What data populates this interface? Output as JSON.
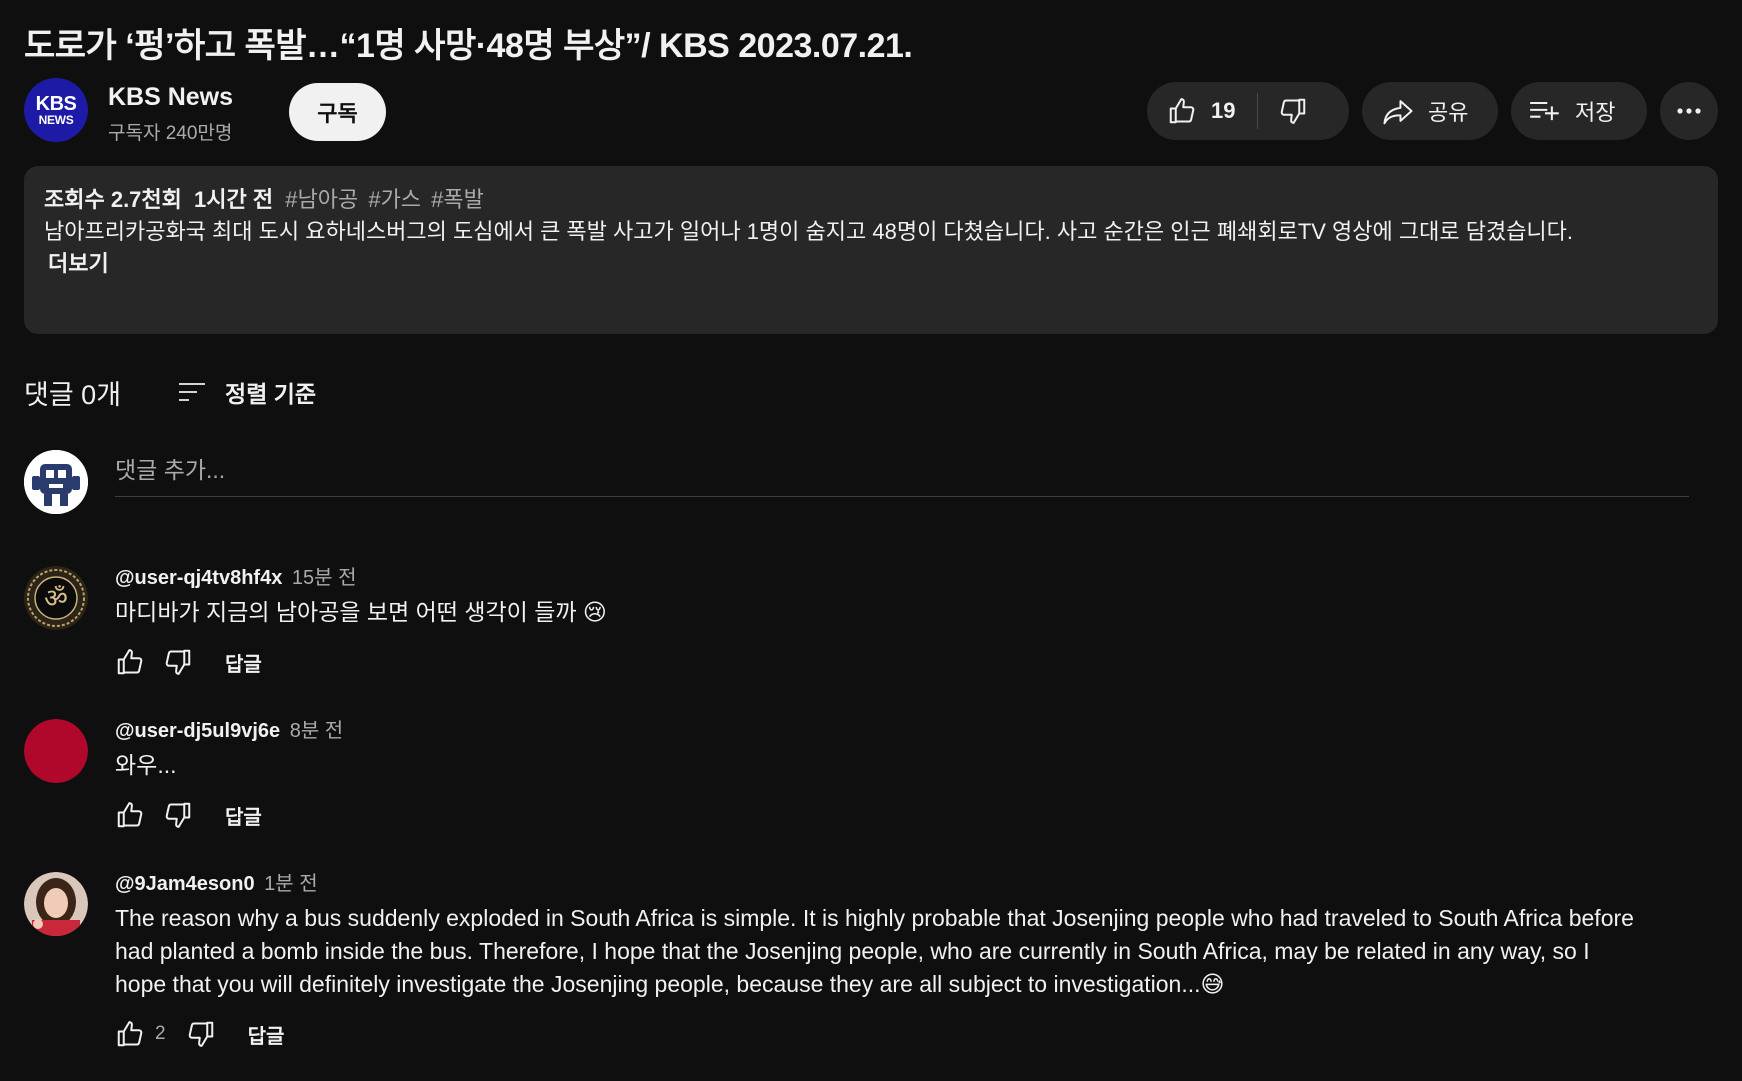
{
  "video": {
    "title": "도로가 ‘펑’하고 폭발…“1명 사망·48명 부상”/ KBS 2023.07.21."
  },
  "channel": {
    "avatar_line1": "KBS",
    "avatar_line2": "NEWS",
    "name": "KBS News",
    "subscribers": "구독자 240만명",
    "subscribe_label": "구독"
  },
  "actions": {
    "like_count": "19",
    "share_label": "공유",
    "save_label": "저장"
  },
  "description": {
    "views": "조회수 2.7천회",
    "time": "1시간 전",
    "tags": [
      "#남아공",
      "#가스",
      "#폭발"
    ],
    "text": "남아프리카공화국 최대 도시 요하네스버그의 도심에서 큰 폭발 사고가 일어나 1명이 숨지고 48명이 다쳤습니다. 사고 순간은 인근 폐쇄회로TV 영상에 그대로 담겼습니다.",
    "more_label": "더보기"
  },
  "comments_section": {
    "count_label": "댓글 0개",
    "sort_label": "정렬 기준",
    "add_placeholder": "댓글 추가..."
  },
  "comments": [
    {
      "author": "@user-qj4tv8hf4x",
      "time": "15분 전",
      "text": "마디바가 지금의 남아공을 보면 어떤 생각이 들까 😢",
      "likes": "",
      "reply_label": "답글"
    },
    {
      "author": "@user-dj5ul9vj6e",
      "time": "8분 전",
      "text": "와우...",
      "likes": "",
      "reply_label": "답글"
    },
    {
      "author": "@9Jam4eson0",
      "time": "1분 전",
      "text": "The reason why a bus suddenly exploded in South Africa is simple.  It is highly probable that Josenjing people who had traveled to South Africa before had planted a bomb inside the bus.  Therefore, I hope that the Josenjing people, who are currently in South Africa, may be related in any way, so I hope that you will definitely investigate the Josenjing people, because they are all subject to investigation...😅",
      "likes": "2",
      "reply_label": "답글"
    }
  ],
  "colors": {
    "background": "#0f0f0f",
    "surface": "#272727",
    "text_primary": "#f1f1f1",
    "text_secondary": "#aaaaaa",
    "kbs_blue": "#1d1ba6",
    "avatar_red": "#b0082a"
  },
  "icons": [
    "thumbs-up-icon",
    "thumbs-down-icon",
    "share-icon",
    "save-playlist-icon",
    "more-icon",
    "sort-icon"
  ]
}
